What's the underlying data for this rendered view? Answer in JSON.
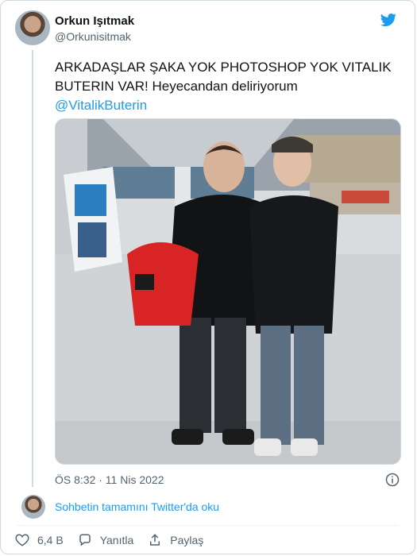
{
  "author": {
    "name": "Orkun Işıtmak",
    "handle": "@Orkunisitmak"
  },
  "tweet": {
    "text_line1": "ARKADAŞLAR ŞAKA YOK PHOTOSHOP YOK VITALIK",
    "text_line2": "BUTERIN VAR! Heyecandan deliriyorum",
    "mention": "@VitalikButerin",
    "timestamp": "ÖS 8:32 · 11 Nis 2022"
  },
  "thread": {
    "read_more": "Sohbetin tamamını Twitter'da oku"
  },
  "actions": {
    "like_count": "6,4 B",
    "reply_label": "Yanıtla",
    "share_label": "Paylaş"
  },
  "colors": {
    "accent": "#1d9bf0",
    "text": "#0f1419",
    "muted": "#536471"
  },
  "icons": [
    "twitter-bird-icon",
    "info-icon",
    "heart-icon",
    "reply-icon",
    "share-icon"
  ]
}
